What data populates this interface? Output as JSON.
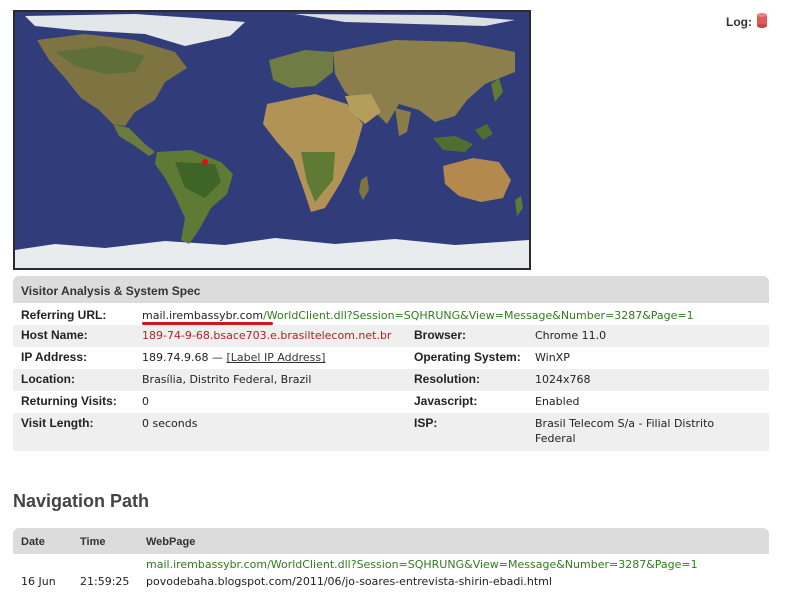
{
  "map": {
    "marker_color": "#e01010",
    "ocean_color": "#303d7a"
  },
  "log": {
    "label": "Log:",
    "icon": "database-icon",
    "icon_color": "#e05a5a"
  },
  "visitor": {
    "title": "Visitor Analysis & System Spec",
    "referring_url_label": "Referring URL:",
    "referring_url_domain": "mail.irembassybr.com",
    "referring_url_path": "/WorldClient.dll?Session=SQHRUNG&View=Message&Number=3287&Page=1",
    "host_name_label": "Host Name:",
    "host_name": "189-74-9-68.bsace703.e.brasiltelecom.net.br",
    "ip_label": "IP Address:",
    "ip_value": "189.74.9.68 —",
    "ip_link": "[Label IP Address]",
    "location_label": "Location:",
    "location": "Brasília, Distrito Federal, Brazil",
    "returning_label": "Returning Visits:",
    "returning": "0",
    "visit_length_label": "Visit Length:",
    "visit_length": "0 seconds",
    "browser_label": "Browser:",
    "browser": "Chrome 11.0",
    "os_label": "Operating System:",
    "os": "WinXP",
    "resolution_label": "Resolution:",
    "resolution": "1024x768",
    "javascript_label": "Javascript:",
    "javascript": "Enabled",
    "isp_label": "ISP:",
    "isp_line1": "Brasil Telecom S/a - Filial Distrito",
    "isp_line2": "Federal"
  },
  "navigation": {
    "title": "Navigation Path",
    "col_date": "Date",
    "col_time": "Time",
    "col_webpage": "WebPage",
    "rows": [
      {
        "date": "16 Jun",
        "time": "21:59:25",
        "referrer": "mail.irembassybr.com/WorldClient.dll?Session=SQHRUNG&View=Message&Number=3287&Page=1",
        "page": "povodebaha.blogspot.com/2011/06/jo-soares-entrevista-shirin-ebadi.html"
      }
    ]
  }
}
